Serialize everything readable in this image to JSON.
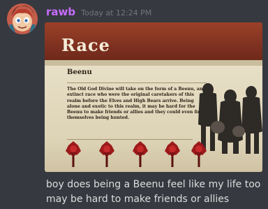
{
  "author": {
    "username": "rawb",
    "timestamp": "Today at 12:24 PM",
    "name_color": "#c76cff"
  },
  "embed": {
    "title": "Race",
    "heading": "Beenu",
    "body": "The Old God Divine will take on the form of a Beenu, an extinct race who were the original caretakers of this realm before the Elves and High Bears arrive. Being alone and exotic to this realm, it may be hard for the Beenu to make friends or allies and they could even find themselves being hunted.",
    "marker_count": 5
  },
  "message": {
    "line1": "boy does being a Beenu feel like my life too",
    "line2": "may be hard to make friends or allies"
  },
  "colors": {
    "background": "#36393f",
    "text": "#dcddde",
    "timestamp": "#72767d"
  }
}
